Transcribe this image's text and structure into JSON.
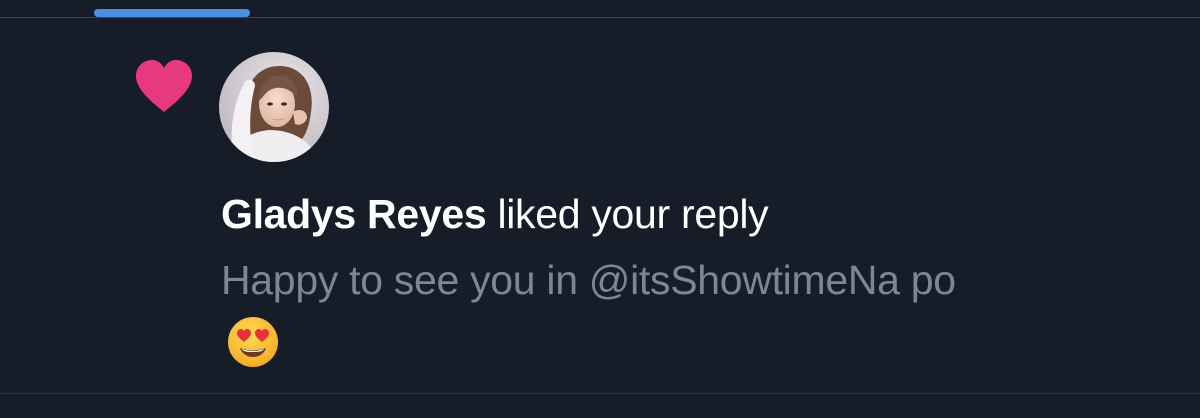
{
  "notification": {
    "type_icon": "heart-icon",
    "user_name": "Gladys Reyes",
    "action_text": "liked your reply",
    "reply_text": "Happy to see you in @itsShowtimeNa po",
    "emoji": "smiling-face-with-heart-eyes",
    "avatar_alt": "Gladys Reyes profile photo"
  },
  "colors": {
    "background": "#161d28",
    "tab_indicator": "#4a8fe0",
    "heart": "#e6397f",
    "primary_text": "#ffffff",
    "secondary_text": "#7b8793"
  }
}
